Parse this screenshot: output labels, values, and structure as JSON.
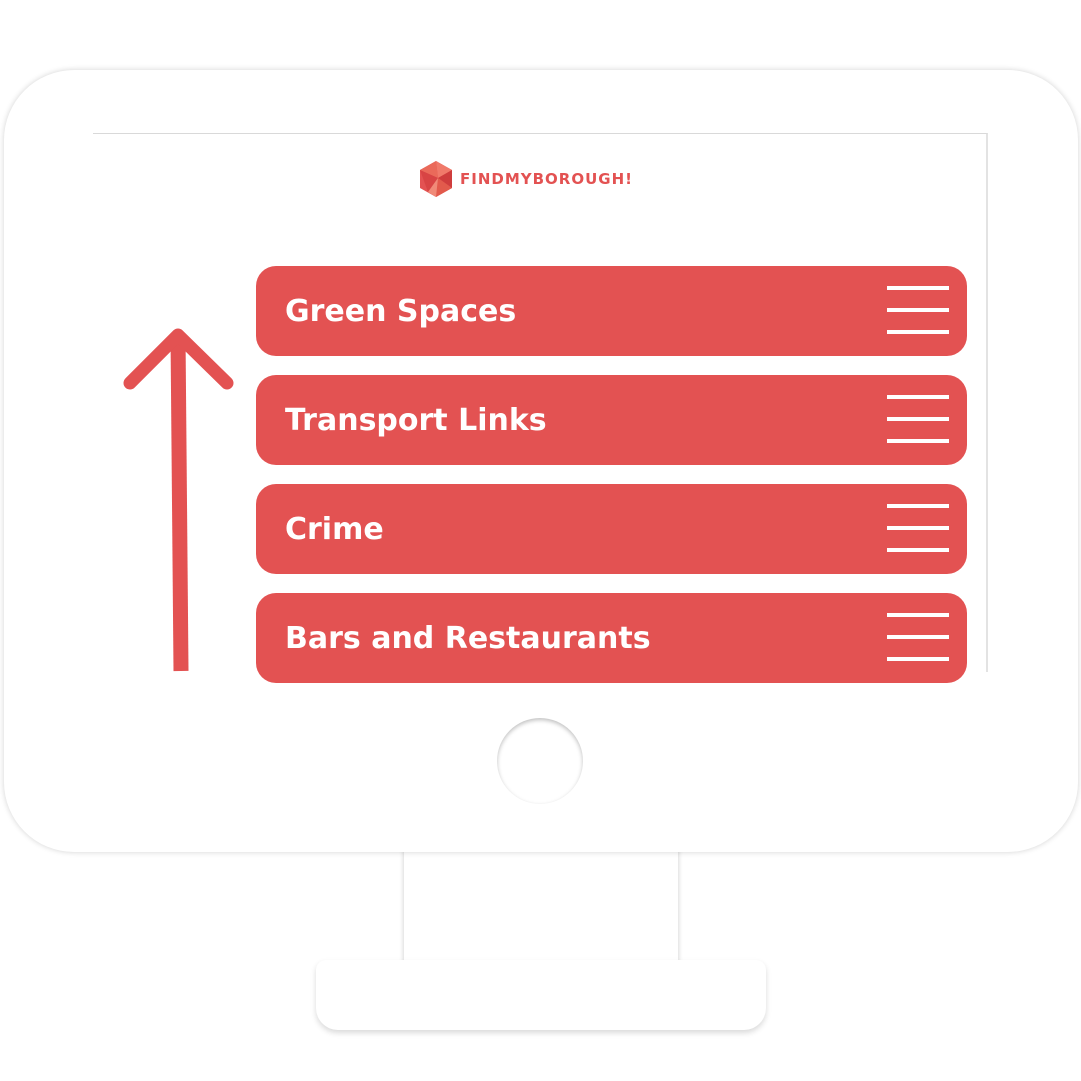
{
  "brand": {
    "name": "FINDMYBOROUGH!",
    "color": "#e35252"
  },
  "menu": {
    "items": [
      {
        "label": "Green Spaces",
        "icon": "hamburger-menu-icon"
      },
      {
        "label": "Transport Links",
        "icon": "hamburger-menu-icon"
      },
      {
        "label": "Crime",
        "icon": "hamburger-menu-icon"
      },
      {
        "label": "Bars and Restaurants",
        "icon": "hamburger-menu-icon"
      }
    ]
  },
  "icons": {
    "logo": "hexagon-logo-icon",
    "arrow": "up-arrow-icon"
  },
  "colors": {
    "accent": "#e35252",
    "text_on_accent": "#ffffff",
    "background": "#ffffff"
  }
}
